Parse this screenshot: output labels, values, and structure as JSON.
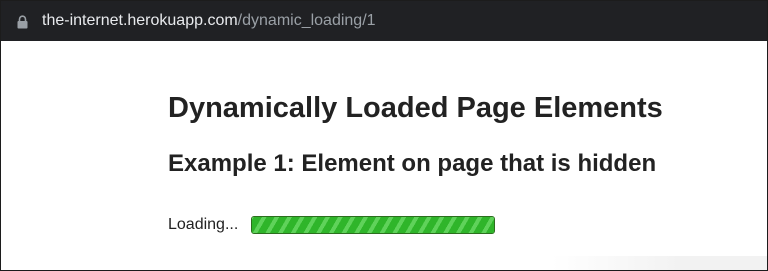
{
  "browser": {
    "url_host": "the-internet.herokuapp.com",
    "url_path": "/dynamic_loading/1",
    "lock_icon": "lock-icon"
  },
  "page": {
    "heading": "Dynamically Loaded Page Elements",
    "subheading": "Example 1: Element on page that is hidden",
    "loading_label": "Loading...",
    "progress_percent": 100,
    "progress_color": "#2fb52a"
  }
}
